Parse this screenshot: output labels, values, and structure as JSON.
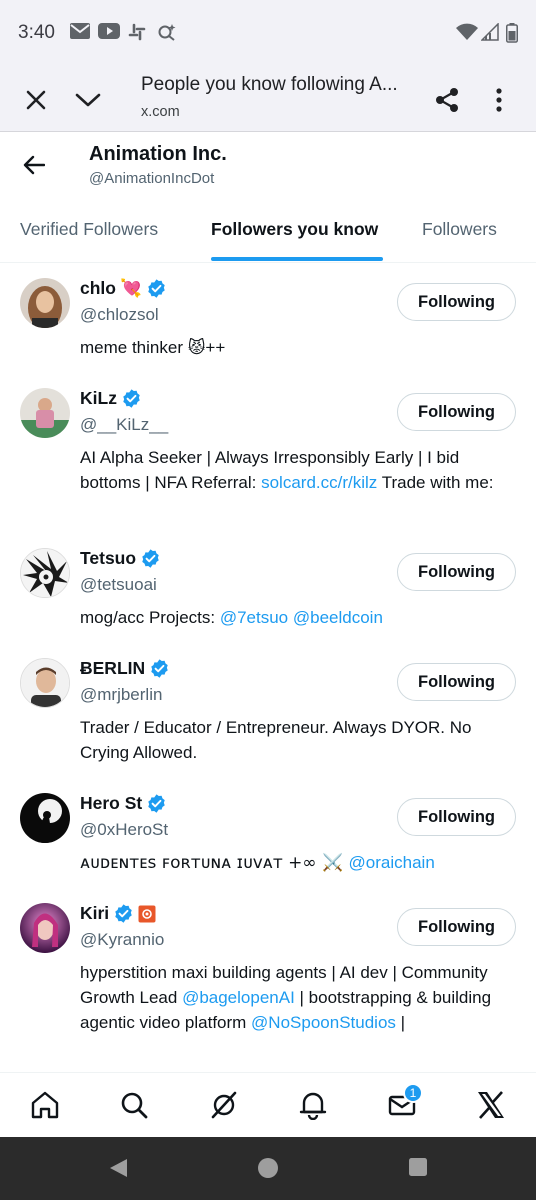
{
  "status_bar": {
    "time": "3:40"
  },
  "browser": {
    "title": "People you know following A...",
    "url": "x.com"
  },
  "profile": {
    "name": "Animation Inc.",
    "handle": "@AnimationIncDot"
  },
  "tabs": [
    {
      "label": "Verified Followers",
      "active": false
    },
    {
      "label": "Followers you know",
      "active": true
    },
    {
      "label": "Followers",
      "active": false
    }
  ],
  "users": [
    {
      "name": "chlo",
      "name_suffix": "💘",
      "handle": "@chlozsol",
      "bio": [
        "meme thinker 😾++"
      ],
      "button": "Following",
      "avatar_color": "#b9957a"
    },
    {
      "name": "KiLz",
      "handle": "@__KiLz__",
      "bio_parts": [
        "AI Alpha Seeker | Always Irresponsibly Early | I bid bottoms | NFA Referral: ",
        "solcard.cc/r/kilz",
        " Trade with me:"
      ],
      "button": "Following",
      "avatar_color": "#c9b8a8"
    },
    {
      "name": "Tetsuo",
      "handle": "@tetsuoai",
      "bio_parts": [
        "mog/acc Projects: ",
        "@7etsuo",
        " ",
        "@beeldcoin"
      ],
      "button": "Following",
      "avatar_color": "#e8e8e8"
    },
    {
      "name": "ɃERLIN",
      "handle": "@mrjberlin",
      "bio": [
        "Trader / Educator / Entrepreneur. Always DYOR. No Crying Allowed."
      ],
      "button": "Following",
      "avatar_color": "#d9c7b8"
    },
    {
      "name": "Hero St",
      "handle": "@0xHeroSt",
      "bio_parts": [
        "ᴀᴜᴅᴇɴᴛᴇꜱ ꜰᴏʀᴛᴜɴᴀ ɪᴜᴠᴀᴛ +∞ ⚔️ ",
        "@oraichain"
      ],
      "button": "Following",
      "avatar_color": "#111111"
    },
    {
      "name": "Kiri",
      "handle": "@Kyrannio",
      "bio_parts": [
        "hyperstition maxi building agents | AI dev | Community Growth Lead ",
        "@bagelopenAI",
        " | bootstrapping & building agentic video platform ",
        "@NoSpoonStudios",
        " |"
      ],
      "button": "Following",
      "avatar_color": "#7a2b6a"
    }
  ],
  "bottom_nav": {
    "items": [
      "home-icon",
      "search-icon",
      "grok-icon",
      "notifications-icon",
      "messages-icon",
      "x-logo-icon"
    ],
    "messages_badge": "1"
  },
  "colors": {
    "accent": "#1d9bf0",
    "text": "#0f1419",
    "secondary": "#536471"
  }
}
